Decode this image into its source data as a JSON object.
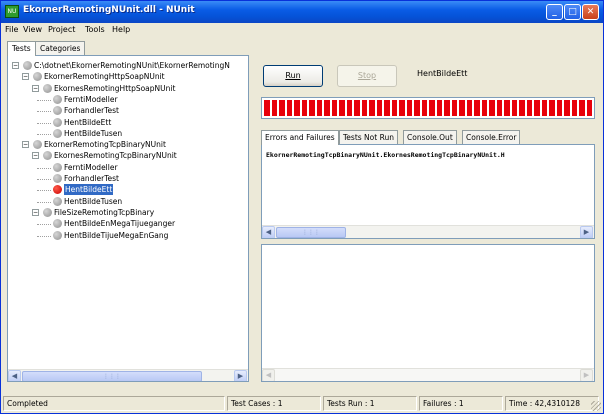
{
  "window": {
    "title": "EkornerRemotingNUnit.dll - NUnit",
    "icon_label": "NU",
    "controls": [
      "minimize-icon",
      "maximize-icon",
      "close-icon"
    ]
  },
  "menu": [
    "File",
    "View",
    "Project",
    "Tools",
    "Help"
  ],
  "left_panel": {
    "tabs": [
      "Tests",
      "Categories"
    ],
    "active_tab": "Tests",
    "tree": [
      {
        "label": "C:\\dotnet\\EkornerRemotingNUnit\\EkornerRemotingN",
        "status": "gray",
        "level": 0
      },
      {
        "label": "EkornerRemotingHttpSoapNUnit",
        "status": "gray",
        "level": 1
      },
      {
        "label": "EkornesRemotingHttpSoapNUnit",
        "status": "gray",
        "level": 2
      },
      {
        "label": "FerntiModeller",
        "status": "gray",
        "level": 3
      },
      {
        "label": "ForhandlerTest",
        "status": "gray",
        "level": 3
      },
      {
        "label": "HentBildeEtt",
        "status": "gray",
        "level": 3
      },
      {
        "label": "HentBildeTusen",
        "status": "gray",
        "level": 3
      },
      {
        "label": "EkornerRemotingTcpBinaryNUnit",
        "status": "gray",
        "level": 1
      },
      {
        "label": "EkornesRemotingTcpBinaryNUnit",
        "status": "gray",
        "level": 2
      },
      {
        "label": "FerntiModeller",
        "status": "gray",
        "level": 3
      },
      {
        "label": "ForhandlerTest",
        "status": "gray",
        "level": 3
      },
      {
        "label": "HentBildeEtt",
        "status": "red",
        "level": 3
      },
      {
        "label": "HentBildeTusen",
        "status": "gray",
        "level": 3
      },
      {
        "label": "FileSizeRemotingTcpBinary",
        "status": "gray",
        "level": 2
      },
      {
        "label": "HentBildeEnMegaTijueganger",
        "status": "gray",
        "level": 3
      },
      {
        "label": "HentBildeTijueMegaEnGang",
        "status": "gray",
        "level": 3
      }
    ]
  },
  "right_panel": {
    "run_label": "Run",
    "stop_label": "Stop",
    "current_test": "HentBildeEtt",
    "progress": {
      "fraction": 1.0,
      "color": "#e8000b"
    },
    "tabs": [
      "Errors and Failures",
      "Tests Not Run",
      "Console.Out",
      "Console.Error"
    ],
    "active_tab": "Errors and Failures",
    "error_text": "EkornerRemotingTcpBinaryNUnit.EkornesRemotingTcpBinaryNUnit.H"
  },
  "status": {
    "state": "Completed",
    "test_cases": "Test Cases : 1",
    "tests_run": "Tests Run : 1",
    "failures": "Failures : 1",
    "time": "Time : 42,4310128"
  }
}
